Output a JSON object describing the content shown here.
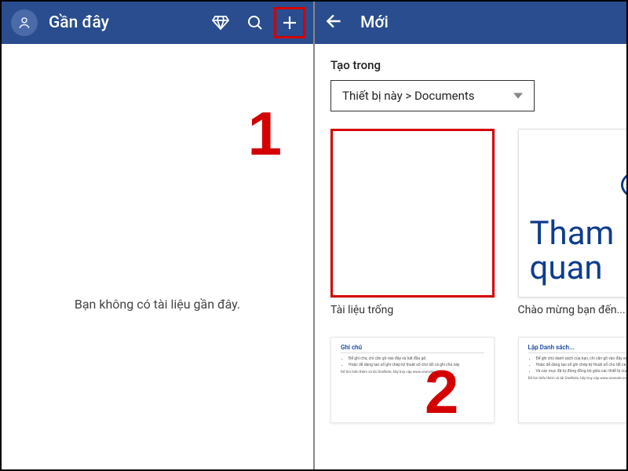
{
  "left": {
    "title": "Gần đây",
    "empty_message": "Bạn không có tài liệu gần đây.",
    "annotation": "1"
  },
  "right": {
    "title": "Mới",
    "section_label": "Tạo trong",
    "location_selector": "Thiết bị này > Documents",
    "templates": {
      "blank": {
        "label": "Tài liệu trống"
      },
      "welcome": {
        "big_word": "Tham quan",
        "label": "Chào mừng bạn đến..."
      }
    },
    "row2": {
      "notes_header": "Ghi chú",
      "list_header": "Lập Danh sách..."
    },
    "annotation": "2"
  },
  "colors": {
    "brand": "#2a4d8f",
    "accent": "#0f3d8c",
    "highlight": "#d40000"
  }
}
